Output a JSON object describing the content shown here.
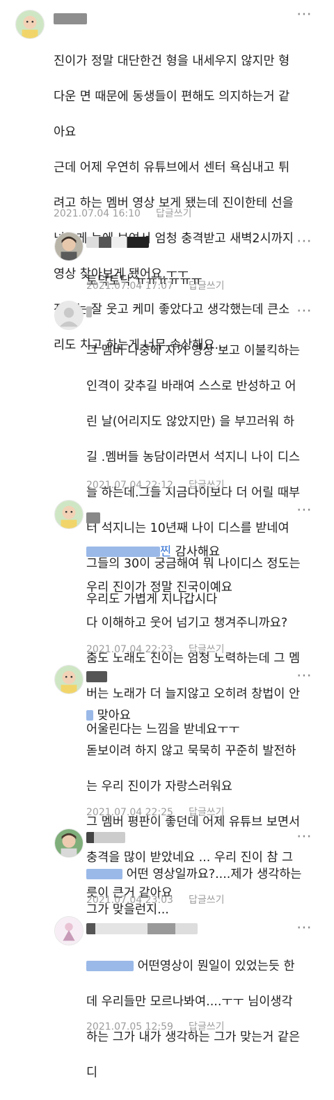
{
  "comments": [
    {
      "lines": [
        "진이가 정말 대단한건 형을 내세우지 않지만 형",
        "다운 면 때문에 동생들이 편해도 의지하는거 같",
        "아요",
        "근데 어제 우연히 유튜브에서 센터 욕심내고 튀",
        "려고 하는 멤버 영상 보게 됐는데 진이한테 선을",
        "넘는게 눈에 보여서 엄청 충격받고 새벽2시까지",
        "영상 찾아보게 됐어요.ㅜㅜ",
        "전에는 잘 웃고 케미 좋았다고 생각했는데 큰소",
        "리도 치고 하는게 너무 속상해요..."
      ],
      "date": "2021.07.04 16:10",
      "reply": "답글쓰기"
    },
    {
      "lines": [
        "토닥토닥 ㅠㅠㅠㅠㅠㅠ"
      ],
      "date": "2021.07.04 17:07",
      "reply": "답글쓰기"
    },
    {
      "lines": [
        "그 멤버 나중에 자기 영상 보고 이불킥하는",
        "인격이 갖추길 바래여 스스로 반성하고 어",
        "린 날(어리지도 않았지만) 을 부끄러워 하",
        "길 .멤버들 농담이라면서 석지니 나이 디스",
        "늘 하는데.그들 지금나이보다 더 어릴 때부",
        "터 석지니는 10년째 나이 디스를 받네여",
        "그들의 30이 궁금해여 뭐 나이디스 정도는",
        "우리도 가볍게 지나갑시다"
      ],
      "date": "2021.07.04 22:12",
      "reply": "답글쓰기"
    },
    {
      "mention_tail": "찐",
      "first_line_rest": " 감사해요",
      "lines": [
        "우리 진이가 정말 진국이예요",
        "다 이해하고 웃어 넘기고 챙겨주니까요?",
        "춤도 노래도 진이는 엄청 노력하는데 그 멤",
        "버는 노래가 더 늘지않고 오히려 창법이 안",
        "어울린다는 느낌을 받네요ㅜㅜ"
      ],
      "date": "2021.07.04 22:23",
      "reply": "답글쓰기"
    },
    {
      "first_line_rest": " 맞아요",
      "lines": [
        "돋보이려 하지 않고 묵묵히 꾸준히 발전하",
        "는 우리 진이가 자랑스러워요",
        "그 멤버 평판이 좋던데 어제 유튜브 보면서",
        "충격을 많이 받았네요 ... 우리 진이 참 그",
        "릇이 큰거 같아요"
      ],
      "date": "2021.07.04 22:25",
      "reply": "답글쓰기"
    },
    {
      "first_line_rest": " 어떤 영상일까요?....제가 생각하는",
      "lines": [
        "그가 맞을런지..."
      ],
      "date": "2021.07.04 23:03",
      "reply": "답글쓰기"
    },
    {
      "first_line_rest": " 어떤영상이 뭔일이 있었는듯 한",
      "lines": [
        "데 우리들만 모르나봐여....ㅜㅜ 님이생각",
        "하는 그가 내가 생각하는 그가 맞는거 같은",
        "디"
      ],
      "date": "2021.07.05 12:59",
      "reply": "답글쓰기"
    }
  ],
  "more_icon": "more-dots-icon",
  "colors": {
    "mention": "#3f7ad6",
    "meta": "#9c9c9c",
    "text": "#1f1f1f"
  }
}
